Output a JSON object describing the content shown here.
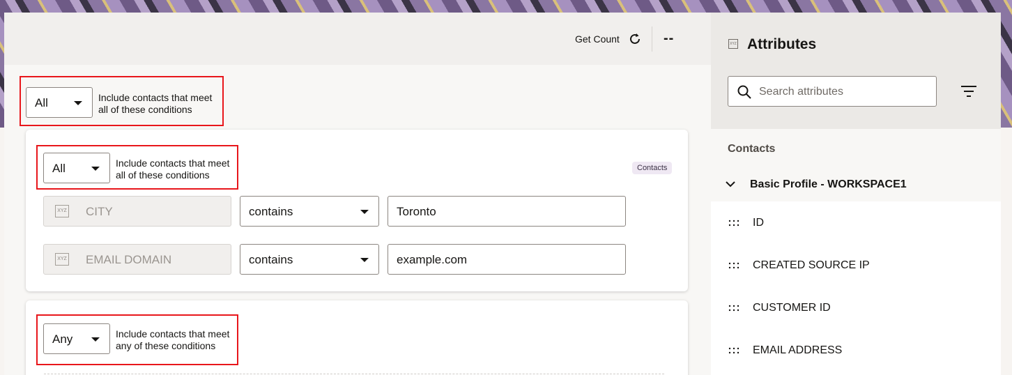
{
  "header": {
    "get_count_label": "Get Count",
    "count_value": "--"
  },
  "root_group": {
    "operator": "All",
    "description": "Include contacts that meet all of these conditions"
  },
  "groups": [
    {
      "operator": "All",
      "description": "Include contacts that meet all of these conditions",
      "badge": "Contacts",
      "conditions": [
        {
          "attribute": "CITY",
          "attribute_icon": "XYZ",
          "operator": "contains",
          "value": "Toronto"
        },
        {
          "attribute": "EMAIL DOMAIN",
          "attribute_icon": "XYZ",
          "operator": "contains",
          "value": "example.com"
        }
      ]
    },
    {
      "operator": "Any",
      "description": "Include contacts that meet any of these conditions"
    }
  ],
  "sidebar": {
    "title": "Attributes",
    "title_icon": "XYZ",
    "search_placeholder": "Search attributes",
    "section": "Contacts",
    "group": "Basic Profile - WORKSPACE1",
    "items": [
      "ID",
      "CREATED SOURCE IP",
      "CUSTOMER ID",
      "EMAIL ADDRESS"
    ]
  },
  "colors": {
    "highlight": "#e8161b",
    "badge_bg": "#efe8f3",
    "banner_purple": "#6e5a86"
  }
}
